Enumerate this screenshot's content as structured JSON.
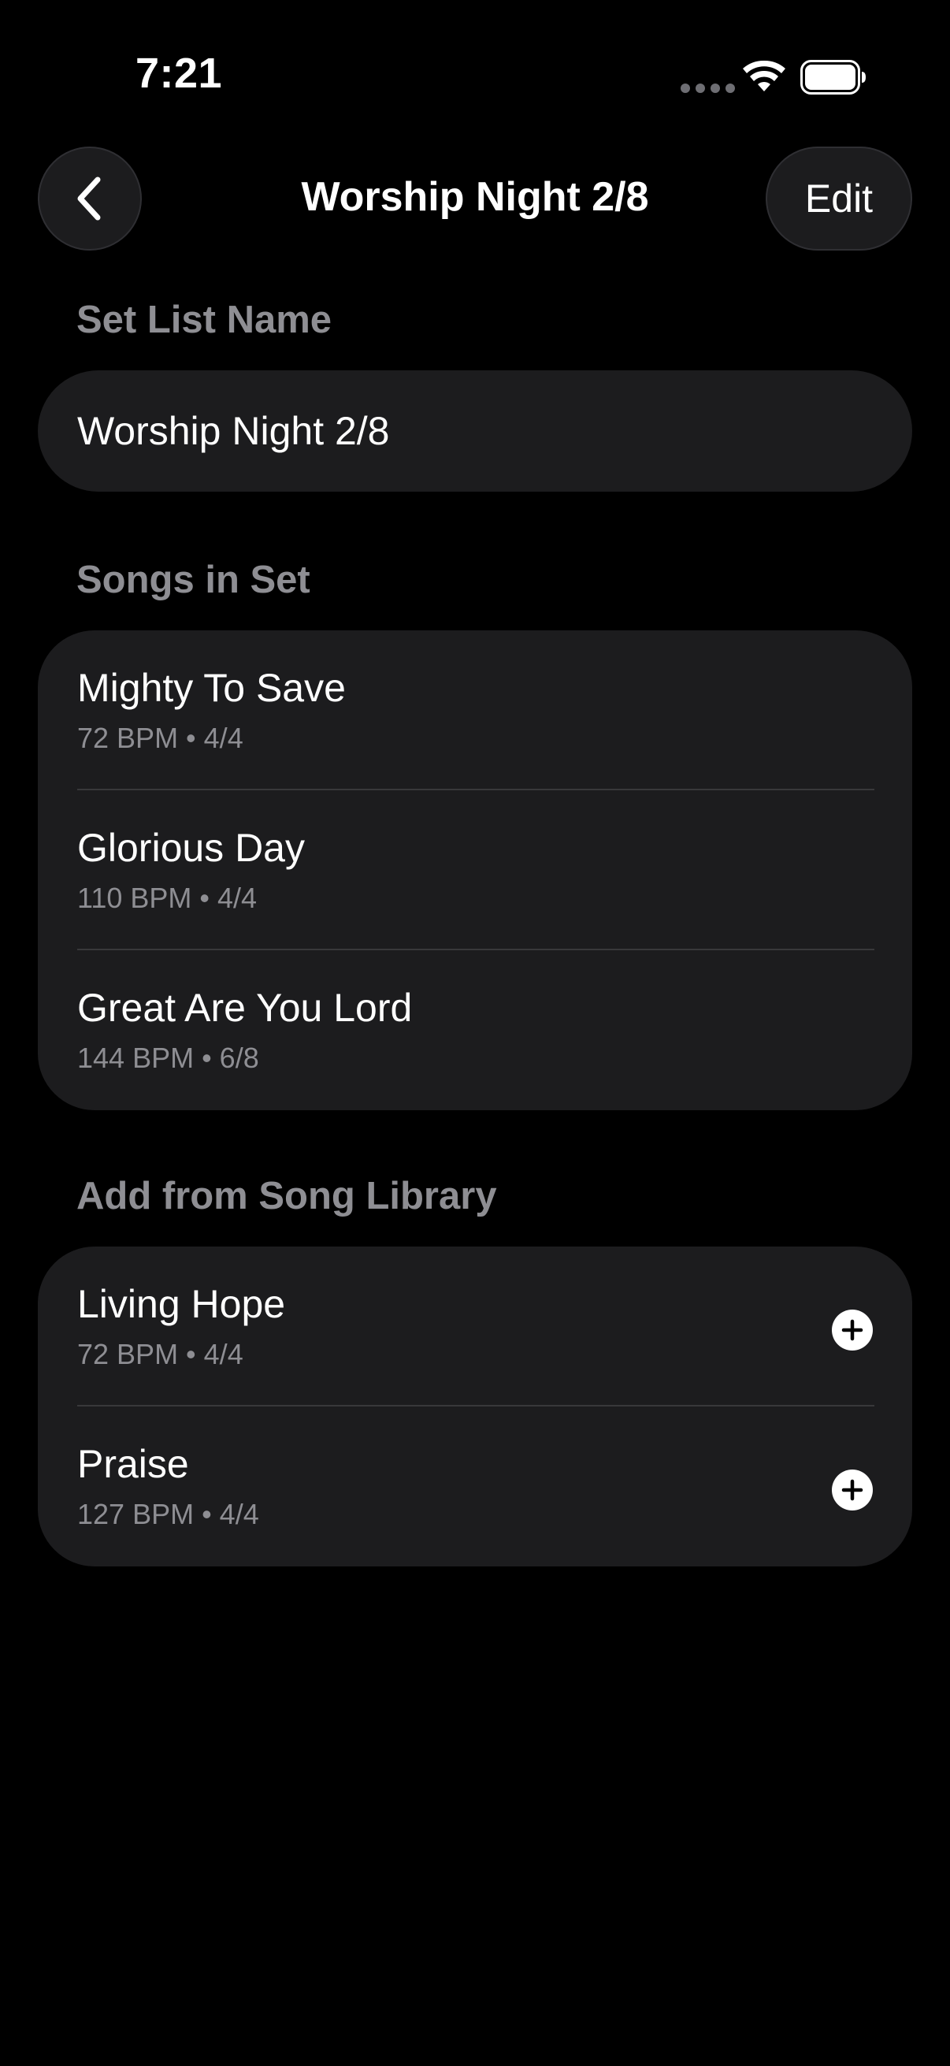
{
  "status_bar": {
    "time": "7:21"
  },
  "nav": {
    "title": "Worship Night 2/8",
    "edit_label": "Edit"
  },
  "set_name_section": {
    "header": "Set List Name",
    "value": "Worship Night 2/8"
  },
  "songs_in_set": {
    "header": "Songs in Set",
    "items": [
      {
        "title": "Mighty To Save",
        "meta": "72 BPM • 4/4"
      },
      {
        "title": "Glorious Day",
        "meta": "110 BPM • 4/4"
      },
      {
        "title": "Great Are You Lord",
        "meta": "144 BPM • 6/8"
      }
    ]
  },
  "library": {
    "header": "Add from Song Library",
    "items": [
      {
        "title": "Living Hope",
        "meta": "72 BPM • 4/4"
      },
      {
        "title": "Praise",
        "meta": "127 BPM • 4/4"
      }
    ]
  },
  "icons": {
    "back": "chevron-left-icon",
    "add": "plus-circle-icon",
    "wifi": "wifi-icon",
    "battery": "battery-icon"
  },
  "colors": {
    "background": "#000000",
    "card": "#1c1c1e",
    "secondary_text": "#8e8e93",
    "divider": "#38383a"
  }
}
